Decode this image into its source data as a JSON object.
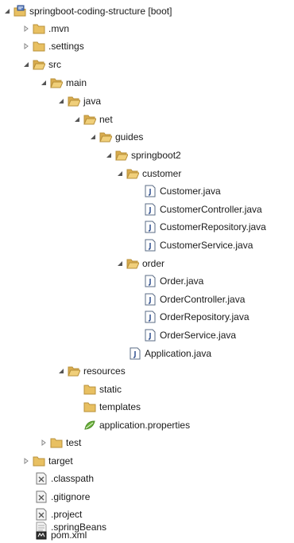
{
  "tree": {
    "root": "springboot-coding-structure [boot]",
    "mvn": ".mvn",
    "settings": ".settings",
    "src": "src",
    "main": "main",
    "java": "java",
    "net": "net",
    "guides": "guides",
    "springboot2": "springboot2",
    "customer": "customer",
    "customer_java": "Customer.java",
    "customer_controller": "CustomerController.java",
    "customer_repository": "CustomerRepository.java",
    "customer_service": "CustomerService.java",
    "order": "order",
    "order_java": "Order.java",
    "order_controller": "OrderController.java",
    "order_repository": "OrderRepository.java",
    "order_service": "OrderService.java",
    "application_java": "Application.java",
    "resources": "resources",
    "static": "static",
    "templates": "templates",
    "application_properties": "application.properties",
    "test": "test",
    "target": "target",
    "classpath": ".classpath",
    "gitignore": ".gitignore",
    "project": ".project",
    "springbeans": ".springBeans",
    "pom": "pom.xml"
  },
  "icons": {
    "folder": "folder-icon",
    "java": "java-file-icon",
    "xml": "xml-file-icon",
    "properties": "properties-file-icon",
    "project": "project-icon"
  },
  "colors": {
    "folder": "#e8c062",
    "folder_dark": "#b8903a",
    "java_border": "#5a6b84",
    "text": "#1a1a1a"
  }
}
